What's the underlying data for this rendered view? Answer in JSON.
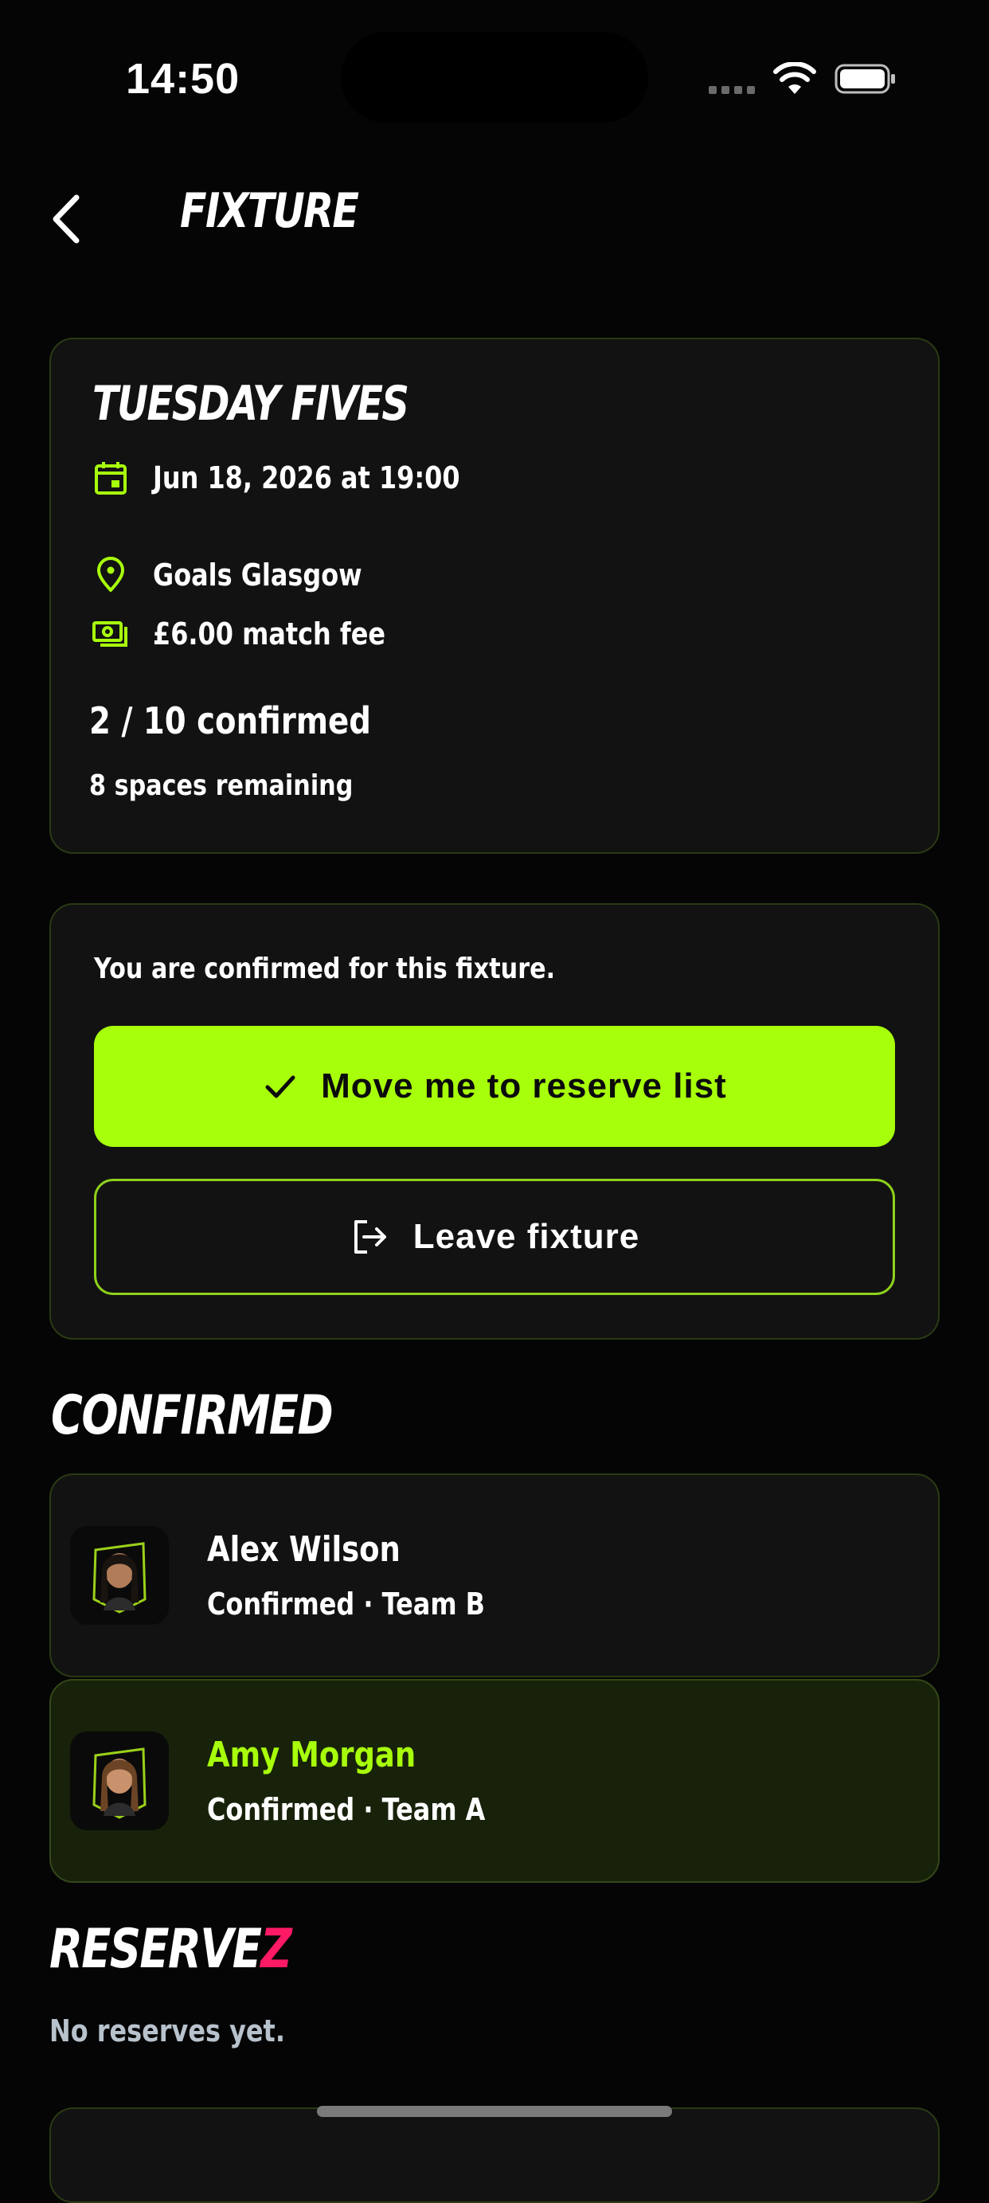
{
  "status_bar": {
    "time": "14:50"
  },
  "header": {
    "title": "FIXTURE",
    "back_icon": "chevron-left-icon"
  },
  "fixture": {
    "name": "TUESDAY FIVES",
    "datetime": "Jun 18, 2026 at 19:00",
    "venue": "Goals Glasgow",
    "fee": "£6.00 match fee",
    "confirmed_count": "2 / 10 confirmed",
    "spaces_remaining": "8 spaces remaining",
    "icons": {
      "date": "calendar-icon",
      "venue": "location-pin-icon",
      "fee": "cash-icon"
    }
  },
  "status_card": {
    "message": "You are confirmed for this fixture.",
    "primary_button": "Move me to reserve list",
    "secondary_button": "Leave fixture"
  },
  "sections": {
    "confirmed_title": "CONFIRMED",
    "reserves_title_main": "RESERVE",
    "reserves_title_accent": "Z",
    "no_reserves": "No reserves yet."
  },
  "players": [
    {
      "name": "Alex Wilson",
      "status": "Confirmed · Team B",
      "is_current_user": false
    },
    {
      "name": "Amy Morgan",
      "status": "Confirmed · Team A",
      "is_current_user": true
    }
  ],
  "colors": {
    "accent": "#a8ff0b",
    "background": "#050505",
    "card": "#121212",
    "highlight_card": "#18220a",
    "reserves_accent": "#ff1a66",
    "muted_text": "#b8c2cc"
  }
}
